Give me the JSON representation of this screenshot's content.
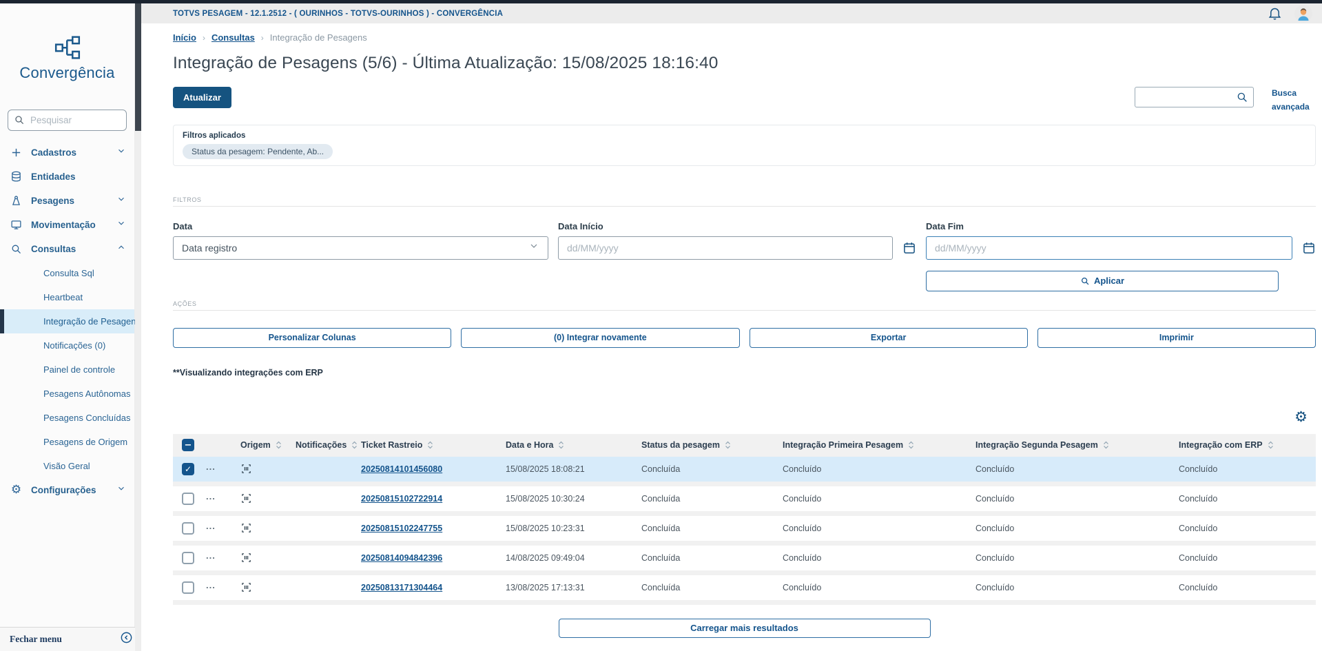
{
  "topbar": {
    "title": "TOTVS PESAGEM - 12.1.2512 - ( OURINHOS - TOTVS-OURINHOS ) - CONVERGÊNCIA"
  },
  "sidebar": {
    "logo_text": "Convergência",
    "search_placeholder": "Pesquisar",
    "items": [
      {
        "label": "Cadastros"
      },
      {
        "label": "Entidades"
      },
      {
        "label": "Pesagens"
      },
      {
        "label": "Movimentação"
      },
      {
        "label": "Consultas"
      }
    ],
    "consultas_children": [
      "Consulta Sql",
      "Heartbeat",
      "Integração de Pesagens",
      "Notificações (0)",
      "Painel de controle",
      "Pesagens Autônomas",
      "Pesagens Concluídas",
      "Pesagens de Origem",
      "Visão Geral"
    ],
    "active_child": "Integração de Pesagens",
    "settings_label": "Configurações",
    "close_menu_label": "Fechar menu"
  },
  "breadcrumb": {
    "items": [
      "Início",
      "Consultas",
      "Integração de Pesagens"
    ]
  },
  "page": {
    "title": "Integração de Pesagens (5/6) - Última Atualização: 15/08/2025 18:16:40",
    "refresh_label": "Atualizar",
    "advanced_search_label": "Busca avançada",
    "applied_filters_label": "Filtros aplicados",
    "filter_chip": "Status da pesagem: Pendente, Ab...",
    "filters_section_label": "FILTROS",
    "actions_section_label": "AÇÕES",
    "note": "**Visualizando integrações com ERP"
  },
  "filters": {
    "data_label": "Data",
    "data_value": "Data registro",
    "data_inicio_label": "Data Início",
    "data_fim_label": "Data Fim",
    "date_placeholder": "dd/MM/yyyy",
    "apply_label": "Aplicar"
  },
  "actions": {
    "buttons": [
      "Personalizar Colunas",
      "(0) Integrar novamente",
      "Exportar",
      "Imprimir"
    ]
  },
  "table": {
    "columns": [
      "Origem",
      "Notificações",
      "Ticket Rastreio",
      "Data e Hora",
      "Status da pesagem",
      "Integração Primeira Pesagem",
      "Integração Segunda Pesagem",
      "Integração com ERP"
    ],
    "rows": [
      {
        "selected": true,
        "ticket": "20250814101456080",
        "datetime": "15/08/2025 18:08:21",
        "status": "Concluída",
        "first": "Concluído",
        "second": "Concluído",
        "erp": "Concluído"
      },
      {
        "selected": false,
        "ticket": "20250815102722914",
        "datetime": "15/08/2025 10:30:24",
        "status": "Concluída",
        "first": "Concluído",
        "second": "Concluído",
        "erp": "Concluído"
      },
      {
        "selected": false,
        "ticket": "20250815102247755",
        "datetime": "15/08/2025 10:23:31",
        "status": "Concluída",
        "first": "Concluído",
        "second": "Concluído",
        "erp": "Concluído"
      },
      {
        "selected": false,
        "ticket": "20250814094842396",
        "datetime": "14/08/2025 09:49:04",
        "status": "Concluída",
        "first": "Concluído",
        "second": "Concluído",
        "erp": "Concluído"
      },
      {
        "selected": false,
        "ticket": "20250813171304464",
        "datetime": "13/08/2025 17:13:31",
        "status": "Concluída",
        "first": "Concluído",
        "second": "Concluído",
        "erp": "Concluído"
      }
    ],
    "load_more_label": "Carregar mais resultados"
  },
  "colors": {
    "primary": "#14548c",
    "primary_button": "#155380",
    "selected_row": "#d7ebfa",
    "active_menu_bg": "#d9edf9",
    "header_band": "#ececec",
    "top_strip": "#1b2430"
  }
}
